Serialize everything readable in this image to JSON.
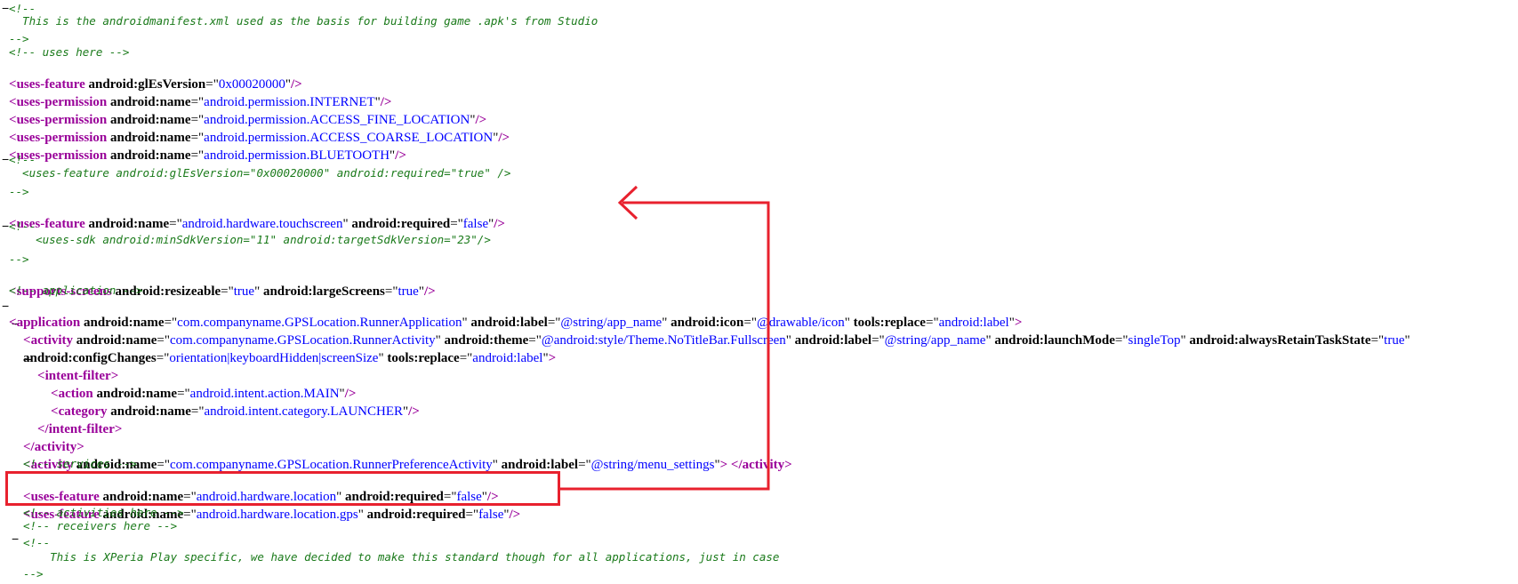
{
  "comments": {
    "header_open": "<!--",
    "header_text": "  This is the androidmanifest.xml used as the basis for building game .apk's from Studio",
    "header_close": "-->",
    "uses_here": "<!-- uses here -->",
    "block2_open": "<!--",
    "block2_text": "  <uses-feature android:glEsVersion=\"0x00020000\" android:required=\"true\" />",
    "block2_close": "-->",
    "block3_open": "<!--",
    "block3_text": "    <uses-sdk android:minSdkVersion=\"11\" android:targetSdkVersion=\"23\"/>",
    "block3_close": "-->",
    "application": "<!-- application -->",
    "services": "<!-- services -->",
    "activities_here": "<!-- activities here -->",
    "receivers_here": "<!-- receivers here -->",
    "xperia_open": "<!--",
    "xperia_text": "    This is XPeria Play specific, we have decided to make this standard though for all applications, just in case",
    "xperia_close": "-->"
  },
  "toggles": {
    "minus": "−"
  },
  "punct": {
    "lt": "<",
    "lt_close": "</",
    "gt": ">",
    "self_close": "/>",
    "self_close_sp": " />",
    "eq": "=",
    "q": "\"",
    "close_then_end": "> </"
  },
  "tags": {
    "uses_feature": "uses-feature",
    "uses_permission": "uses-permission",
    "supports_screens": "supports-screens",
    "application": "application",
    "activity": "activity",
    "intent_filter": "intent-filter",
    "action": "action",
    "category": "category"
  },
  "attrs": {
    "glEsVersion": "android:glEsVersion",
    "name": "android:name",
    "required": "android:required",
    "resizeable": "android:resizeable",
    "largeScreens": "android:largeScreens",
    "label": "android:label",
    "icon": "android:icon",
    "replace": "tools:replace",
    "theme": "android:theme",
    "launchMode": "android:launchMode",
    "alwaysRetain": "android:alwaysRetainTaskState",
    "configChanges": "android:configChanges"
  },
  "values": {
    "gles": "0x00020000",
    "perm_internet": "android.permission.INTERNET",
    "perm_fine": "android.permission.ACCESS_FINE_LOCATION",
    "perm_coarse": "android.permission.ACCESS_COARSE_LOCATION",
    "perm_bt": "android.permission.BLUETOOTH",
    "touchscreen": "android.hardware.touchscreen",
    "false": "false",
    "true": "true",
    "app_name_class": "com.companyname.GPSLocation.RunnerApplication",
    "app_label": "@string/app_name",
    "app_icon": "@drawable/icon",
    "replace_label": "android:label",
    "activity_class": "com.companyname.GPSLocation.RunnerActivity",
    "theme": "@android:style/Theme.NoTitleBar.Fullscreen",
    "single_top": "singleTop",
    "config_changes": "orientation|keyboardHidden|screenSize",
    "action_main": "android.intent.action.MAIN",
    "cat_launcher": "android.intent.category.LAUNCHER",
    "pref_activity": "com.companyname.GPSLocation.RunnerPreferenceActivity",
    "menu_settings": "@string/menu_settings",
    "hw_location": "android.hardware.location",
    "hw_location_gps": "android.hardware.location.gps"
  },
  "colors": {
    "annotation": "#e8212e",
    "tag": "#990099",
    "value": "#0000ff",
    "comment": "#1a7a1a"
  }
}
